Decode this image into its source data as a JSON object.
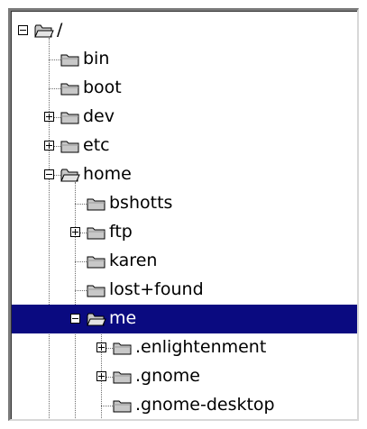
{
  "tree": {
    "nodes": [
      {
        "label": "/",
        "depth": 0,
        "expander": "minus",
        "folder": "open"
      },
      {
        "label": "bin",
        "depth": 1,
        "expander": "none",
        "folder": "closed"
      },
      {
        "label": "boot",
        "depth": 1,
        "expander": "none",
        "folder": "closed"
      },
      {
        "label": "dev",
        "depth": 1,
        "expander": "plus",
        "folder": "closed"
      },
      {
        "label": "etc",
        "depth": 1,
        "expander": "plus",
        "folder": "closed"
      },
      {
        "label": "home",
        "depth": 1,
        "expander": "minus",
        "folder": "open"
      },
      {
        "label": "bshotts",
        "depth": 2,
        "expander": "none",
        "folder": "closed"
      },
      {
        "label": "ftp",
        "depth": 2,
        "expander": "plus",
        "folder": "closed"
      },
      {
        "label": "karen",
        "depth": 2,
        "expander": "none",
        "folder": "closed"
      },
      {
        "label": "lost+found",
        "depth": 2,
        "expander": "none",
        "folder": "closed"
      },
      {
        "label": "me",
        "depth": 2,
        "expander": "minus",
        "folder": "open",
        "selected": true
      },
      {
        "label": ".enlightenment",
        "depth": 3,
        "expander": "plus",
        "folder": "closed"
      },
      {
        "label": ".gnome",
        "depth": 3,
        "expander": "plus",
        "folder": "closed"
      },
      {
        "label": ".gnome-desktop",
        "depth": 3,
        "expander": "none",
        "folder": "closed"
      }
    ]
  },
  "colors": {
    "selection": "#0a0a80",
    "folder_fill": "#c8c8c8",
    "folder_stroke": "#000000"
  },
  "icons": {
    "open": "folder-open-icon",
    "closed": "folder-icon",
    "minus": "collapse-icon",
    "plus": "expand-icon"
  }
}
